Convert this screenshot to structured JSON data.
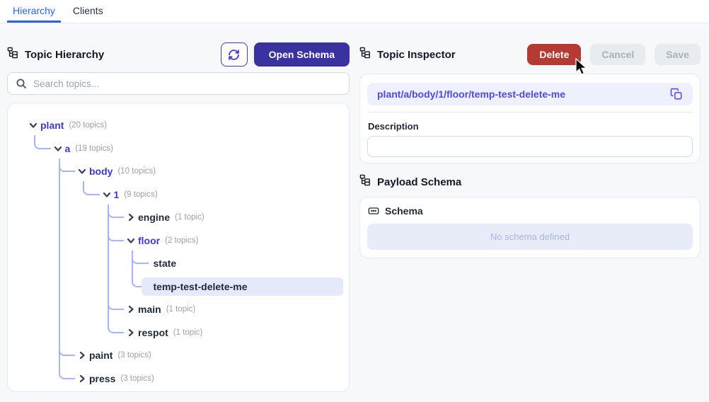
{
  "tabs": [
    {
      "label": "Hierarchy",
      "active": true
    },
    {
      "label": "Clients",
      "active": false
    }
  ],
  "left": {
    "title": "Topic Hierarchy",
    "open_schema_label": "Open Schema",
    "search_placeholder": "Search topics...",
    "tree": [
      {
        "label": "plant",
        "count": "(20 topics)",
        "level": 0,
        "state": "expanded",
        "selected": false
      },
      {
        "label": "a",
        "count": "(19 topics)",
        "level": 1,
        "state": "expanded",
        "selected": false
      },
      {
        "label": "body",
        "count": "(10 topics)",
        "level": 2,
        "state": "expanded",
        "selected": false
      },
      {
        "label": "1",
        "count": "(9 topics)",
        "level": 3,
        "state": "expanded",
        "selected": false
      },
      {
        "label": "engine",
        "count": "(1 topic)",
        "level": 4,
        "state": "collapsed",
        "selected": false
      },
      {
        "label": "floor",
        "count": "(2 topics)",
        "level": 4,
        "state": "expanded",
        "selected": false
      },
      {
        "label": "state",
        "count": "",
        "level": 5,
        "state": "leaf",
        "selected": false
      },
      {
        "label": "temp-test-delete-me",
        "count": "",
        "level": 5,
        "state": "leaf",
        "selected": true
      },
      {
        "label": "main",
        "count": "(1 topic)",
        "level": 4,
        "state": "collapsed",
        "selected": false
      },
      {
        "label": "respot",
        "count": "(1 topic)",
        "level": 4,
        "state": "collapsed",
        "selected": false
      },
      {
        "label": "paint",
        "count": "(3 topics)",
        "level": 2,
        "state": "collapsed",
        "selected": false
      },
      {
        "label": "press",
        "count": "(3 topics)",
        "level": 2,
        "state": "collapsed",
        "selected": false
      }
    ]
  },
  "right": {
    "title": "Topic Inspector",
    "delete_label": "Delete",
    "cancel_label": "Cancel",
    "save_label": "Save",
    "topic_path": "plant/a/body/1/floor/temp-test-delete-me",
    "description_label": "Description",
    "description_value": "",
    "payload_title": "Payload Schema",
    "schema_label": "Schema",
    "no_schema_text": "No schema defined"
  },
  "icons": {
    "hierarchy": "tree-structure",
    "refresh": "refresh-cw",
    "search": "magnifier",
    "copy": "copy",
    "schema": "rectangle-ellipsis",
    "chevron_expanded": "chevron-down",
    "chevron_collapsed": "chevron-right"
  },
  "colors": {
    "tab_active": "#2563eb",
    "expanded_node": "#3f38cf",
    "connector": "#a5b4fc",
    "selected_row_bg": "#e4eafb",
    "open_schema_bg": "#3a329e",
    "delete_bg": "#b53a34",
    "disabled_bg": "#e9ecef",
    "path_pill_bg": "#eef1fd",
    "path_text": "#5048d8",
    "no_schema_bg": "#e8ecf9"
  }
}
